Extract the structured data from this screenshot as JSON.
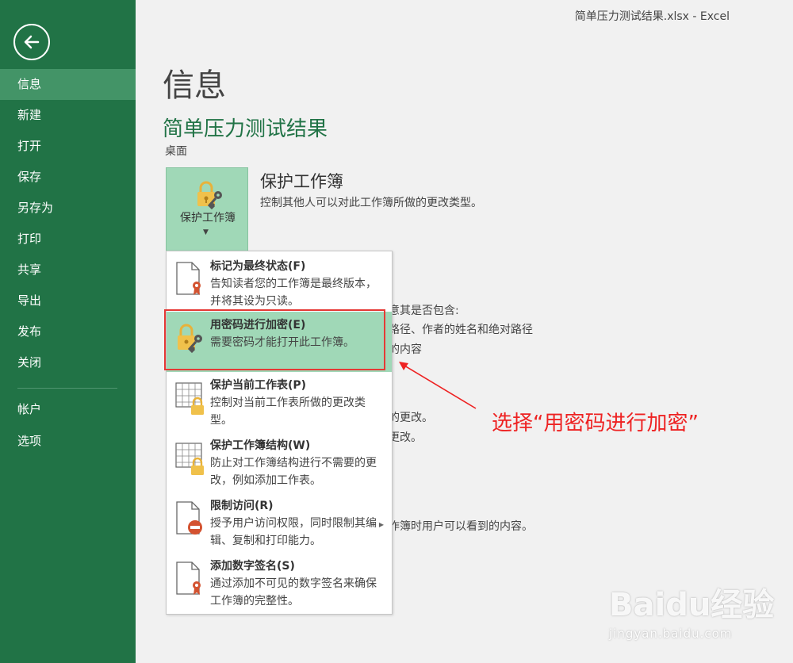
{
  "window": {
    "title": "简单压力测试结果.xlsx - Excel"
  },
  "sidebar": {
    "items": [
      {
        "label": "信息"
      },
      {
        "label": "新建"
      },
      {
        "label": "打开"
      },
      {
        "label": "保存"
      },
      {
        "label": "另存为"
      },
      {
        "label": "打印"
      },
      {
        "label": "共享"
      },
      {
        "label": "导出"
      },
      {
        "label": "发布"
      },
      {
        "label": "关闭"
      },
      {
        "label": "帐户"
      },
      {
        "label": "选项"
      }
    ]
  },
  "main": {
    "page_title": "信息",
    "doc_name": "简单压力测试结果",
    "doc_location": "桌面",
    "protect_button_label": "保护工作簿",
    "section_heading": "保护工作簿",
    "section_desc": "控制其他人可以对此工作簿所做的更改类型。",
    "bg_texts": [
      "意其是否包含:",
      "路径、作者的姓名和绝对路径",
      "的内容",
      "的更改。",
      "更改。",
      "作簿时用户可以看到的内容。"
    ]
  },
  "dropdown": {
    "items": [
      {
        "title": "标记为最终状态(F)",
        "desc": "告知读者您的工作簿是最终版本，并将其设为只读。"
      },
      {
        "title": "用密码进行加密(E)",
        "desc": "需要密码才能打开此工作簿。"
      },
      {
        "title": "保护当前工作表(P)",
        "desc": "控制对当前工作表所做的更改类型。"
      },
      {
        "title": "保护工作簿结构(W)",
        "desc": "防止对工作簿结构进行不需要的更改，例如添加工作表。"
      },
      {
        "title": "限制访问(R)",
        "desc": "授予用户访问权限，同时限制其编辑、复制和打印能力。"
      },
      {
        "title": "添加数字签名(S)",
        "desc": "通过添加不可见的数字签名来确保工作簿的完整性。"
      }
    ]
  },
  "annotation": {
    "text": "选择“用密码进行加密”"
  },
  "watermark": {
    "brand": "Baidu经验",
    "url": "jingyan.baidu.com"
  },
  "colors": {
    "accent": "#217346",
    "highlight": "#a0d8b7",
    "annotation": "#ee2222"
  }
}
